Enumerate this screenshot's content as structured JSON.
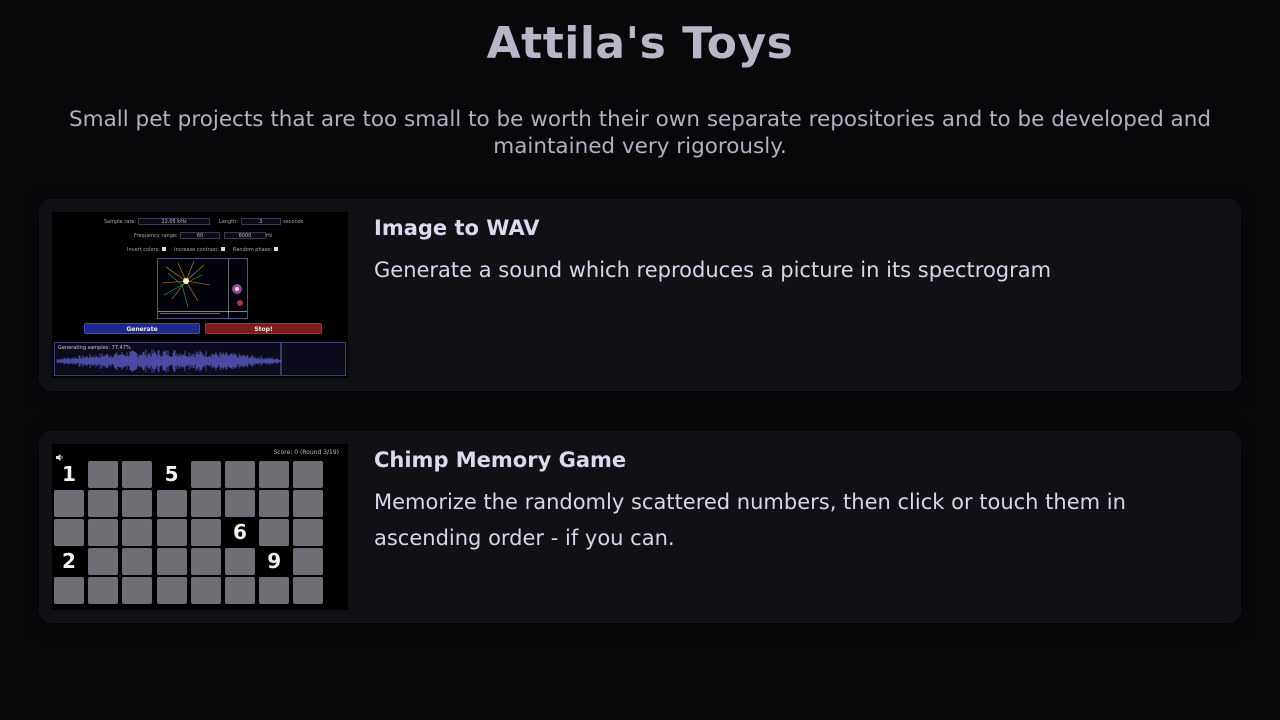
{
  "page": {
    "title": "Attila's Toys",
    "subtitle": "Small pet projects that are too small to be worth their own separate repositories and to be developed and maintained very rigorously."
  },
  "projects": [
    {
      "title": "Image to WAV",
      "description": "Generate a sound which reproduces a picture in its spectrogram",
      "thumbnail": {
        "sample_rate_label": "Sample rate:",
        "sample_rate_value": "22.05 kHz",
        "length_label": "Length:",
        "length_value": "3",
        "length_unit": "seconds",
        "frequency_label": "Frequency range:",
        "freq_min": "60",
        "freq_max": "8000",
        "freq_unit": "Hz",
        "invert_label": "Invert colors:",
        "contrast_label": "Increase contrast:",
        "phase_label": "Random phase:",
        "generate_label": "Generate",
        "stop_label": "Stop!",
        "status": "Generating samples: 77.47%",
        "progress": 0.7747
      }
    },
    {
      "title": "Chimp Memory Game",
      "description": "Memorize the randomly scattered numbers, then click or touch them in ascending order - if you can.",
      "thumbnail": {
        "score": "Score: 0 (Round 3/19)",
        "numbers": [
          {
            "n": "1",
            "row": 0,
            "col": 0
          },
          {
            "n": "5",
            "row": 0,
            "col": 3
          },
          {
            "n": "6",
            "row": 2,
            "col": 5
          },
          {
            "n": "2",
            "row": 3,
            "col": 0
          },
          {
            "n": "9",
            "row": 3,
            "col": 6
          }
        ],
        "empty_cells": [
          [
            0,
            0
          ],
          [
            4,
            0
          ],
          [
            0,
            3
          ],
          [
            0,
            5
          ],
          [
            5,
            2
          ],
          [
            0,
            3
          ]
        ]
      }
    }
  ],
  "colors": {
    "background": "#08080b",
    "card": "#101114",
    "generate_button": "#1e2a8a",
    "stop_button": "#7e1a1a",
    "tile": "#6e6e74"
  }
}
